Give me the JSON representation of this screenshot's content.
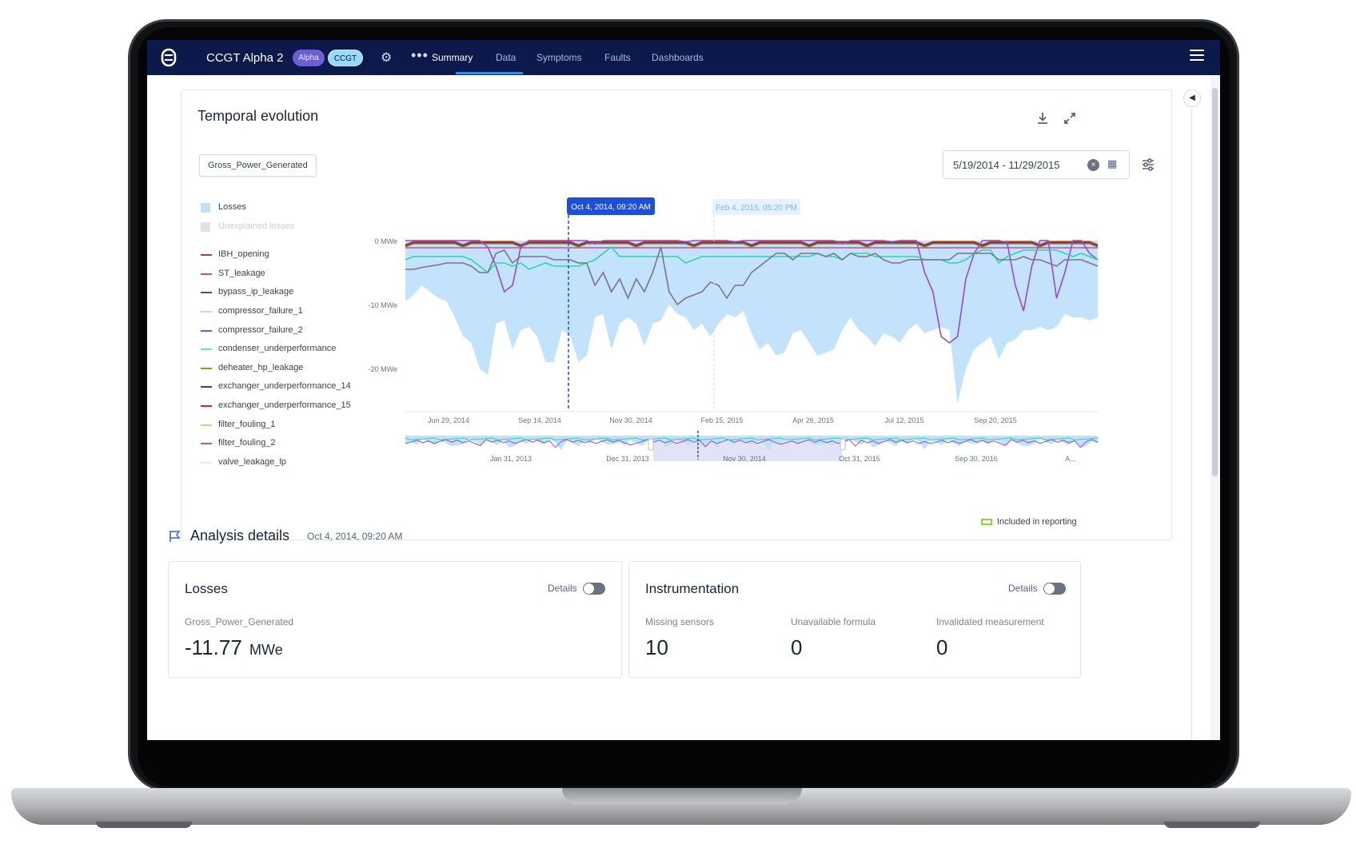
{
  "navbar": {
    "app_title": "CCGT Alpha 2",
    "badge_alpha": "Alpha",
    "badge_ccgt": "CCGT",
    "tabs": [
      {
        "label": "Summary",
        "active": true
      },
      {
        "label": "Data",
        "active": false
      },
      {
        "label": "Symptoms",
        "active": false
      },
      {
        "label": "Faults",
        "active": false
      },
      {
        "label": "Dashboards",
        "active": false
      }
    ],
    "icons": [
      "logo-icon",
      "gear-icon",
      "more-icon",
      "hamburger-menu-icon"
    ]
  },
  "temporal": {
    "title": "Temporal evolution",
    "variable_chip": "Gross_Power_Generated",
    "date_range": "5/19/2014 - 11/29/2015",
    "reporting_label": "Included in reporting",
    "marker_primary": "Oct 4, 2014, 09:20 AM",
    "marker_secondary": "Feb 4, 2015, 05:20 PM",
    "icons": [
      "download-icon",
      "expand-icon",
      "clear-icon",
      "calendar-icon",
      "filter-settings-icon"
    ]
  },
  "legend": {
    "areas": [
      {
        "label": "Losses",
        "color": "#bfe1fb"
      },
      {
        "label": "Unexplained losses",
        "color": "#dfe2e7"
      }
    ],
    "lines": [
      {
        "label": "IBH_opening",
        "color": "#b0413e"
      },
      {
        "label": "ST_leakage",
        "color": "#c75a4e"
      },
      {
        "label": "bypass_ip_leakage",
        "color": "#37538f"
      },
      {
        "label": "compressor_failure_1",
        "color": "#b8e3c8"
      },
      {
        "label": "compressor_failure_2",
        "color": "#9a47d6"
      },
      {
        "label": "condenser_underperformance",
        "color": "#5ee6c8"
      },
      {
        "label": "deheater_hp_leakage",
        "color": "#8a9a12"
      },
      {
        "label": "exchanger_underperformance_14",
        "color": "#3f3a8a"
      },
      {
        "label": "exchanger_underperformance_15",
        "color": "#d42626"
      },
      {
        "label": "filter_fouling_1",
        "color": "#d9d27a"
      },
      {
        "label": "filter_fouling_2",
        "color": "#c24fae"
      },
      {
        "label": "valve_leakage_lp",
        "color": "#e6e6e6"
      }
    ]
  },
  "chart_data": {
    "type": "area",
    "ylabel_ticks": [
      "0 MWe",
      "-10 MWe",
      "-20 MWe"
    ],
    "ylim": [
      -26,
      0
    ],
    "x_ticks": [
      "Jun 29, 2014",
      "Sep 14, 2014",
      "Nov 30, 2014",
      "Feb 15, 2015",
      "Apr 26, 2015",
      "Jul 12, 2015",
      "Sep 20, 2015"
    ],
    "overview_ticks": [
      "Jan 31, 2013",
      "Dec 31, 2013",
      "Nov 30, 2014",
      "Oct 31, 2015",
      "Sep 30, 2016",
      "A..."
    ],
    "series": [
      {
        "name": "Losses",
        "values": [
          -9.5,
          -8.5,
          -7,
          -8,
          -9,
          -9.5,
          -12,
          -15,
          -16,
          -20,
          -21,
          -13,
          -12.5,
          -17,
          -14,
          -13.5,
          -15,
          -19,
          -19,
          -14,
          -15,
          -19,
          -18,
          -12,
          -11.5,
          -17,
          -13,
          -12,
          -13,
          -16.5,
          -13,
          -12.5,
          -10,
          -11.5,
          -12,
          -14,
          -13,
          -15,
          -13,
          -11.5,
          -12,
          -11,
          -14.5,
          -17,
          -16,
          -18,
          -17.5,
          -14.5,
          -14,
          -16,
          -18,
          -17.5,
          -17,
          -14,
          -12,
          -14,
          -15,
          -16.5,
          -14.5,
          -15,
          -16,
          -14,
          -13,
          -14.5,
          -14,
          -13.5,
          -14,
          -25.5,
          -20,
          -17,
          -16,
          -15,
          -18.5,
          -16,
          -15.5,
          -14,
          -14,
          -13.5,
          -14,
          -13.5,
          -11.5,
          -12,
          -12,
          -12.5,
          -12
        ]
      },
      {
        "name": "compressor_failure_2",
        "values": [
          0,
          0,
          0,
          0,
          0,
          0,
          0,
          0,
          0,
          0,
          -1,
          -4,
          -8,
          -7,
          -1,
          0,
          0,
          0,
          0,
          0,
          0,
          0,
          0,
          -0.5,
          0,
          0,
          0,
          0,
          0,
          0,
          0,
          0,
          0,
          0,
          -0.2,
          0,
          0,
          0,
          0,
          0,
          -0.2,
          0,
          0,
          0,
          0,
          0,
          0,
          0,
          0,
          0,
          0,
          0,
          0,
          -0.5,
          0,
          0,
          0,
          0,
          0,
          -0.2,
          0,
          0,
          0,
          -5,
          -8,
          -15,
          -16,
          -15,
          -6,
          -2,
          0,
          0,
          0,
          -0.3,
          -7,
          -11,
          -4,
          0,
          0,
          -9,
          -5,
          0,
          0,
          -2,
          -3
        ]
      },
      {
        "name": "condenser_underperformance",
        "values": [
          -3,
          -2.5,
          -2.5,
          -2.5,
          -2.5,
          -2.5,
          -2.5,
          -2.5,
          -3,
          -4,
          -5,
          -3.5,
          -3.5,
          -4,
          -3.5,
          -4.5,
          -4,
          -3.5,
          -4,
          -4,
          -4,
          -4,
          -3.5,
          -3,
          -2,
          -1,
          -2.5,
          -2.5,
          -2.5,
          -2.5,
          -2.5,
          -2.5,
          -2.5,
          -2.5,
          -3.5,
          -3,
          -2.5,
          -2.5,
          -2.5,
          -2.5,
          -2.5,
          -2.5,
          -2.5,
          -2.5,
          -2.5,
          -2.5,
          -2.5,
          -2.5,
          -2.5,
          -2.5,
          -2,
          -2.5,
          -2.5,
          -3,
          -2,
          -2,
          -2,
          -2.5,
          -2.5,
          -2.5,
          -2.5,
          -2.5,
          -2.5,
          -3,
          -3,
          -3,
          -3.5,
          -3.5,
          -3,
          -2,
          -1.5,
          -1.5,
          -3.5,
          -2.5,
          -2,
          -1.5,
          -1.5,
          -1.5,
          -1.5,
          -1.5,
          -2,
          -2.5,
          -2,
          -2.5,
          -3
        ]
      },
      {
        "name": "IBH_opening",
        "values": [
          -4.5,
          -4.5,
          -4.2,
          -4,
          -3.8,
          -3.5,
          -3.5,
          -3.5,
          -4,
          -5,
          -5,
          -2,
          -1.5,
          -3.5,
          -2.5,
          -2.5,
          -2.5,
          -2.5,
          -3,
          -3,
          -3,
          -3.5,
          -3.5,
          -7,
          -5,
          -8,
          -6,
          -9,
          -6,
          -8,
          -5,
          -1,
          -8,
          -10,
          -9,
          -8.5,
          -8,
          -6.5,
          -7,
          -9,
          -7,
          -7,
          -5,
          -4,
          -3,
          -2,
          -2,
          -3,
          -2,
          -2,
          -2,
          -2.5,
          -2,
          -3,
          -2,
          -2.5,
          -2.5,
          -2,
          -3,
          -3.5,
          -3.5,
          -3,
          -3,
          -3,
          -3,
          -3,
          -3,
          -2,
          -2,
          -2,
          -2,
          -2,
          -3,
          -3,
          -3,
          -2.5,
          -3,
          -3,
          -3.5,
          -4,
          -3,
          -3,
          -3,
          -3.5,
          -4
        ]
      }
    ]
  },
  "analysis": {
    "title": "Analysis details",
    "date": "Oct 4, 2014, 09:20 AM",
    "losses": {
      "title": "Losses",
      "details_label": "Details",
      "metric_label": "Gross_Power_Generated",
      "value": "-11.77",
      "unit": "MWe"
    },
    "instrumentation": {
      "title": "Instrumentation",
      "details_label": "Details",
      "metrics": [
        {
          "label": "Missing sensors",
          "value": "10"
        },
        {
          "label": "Unavailable formula",
          "value": "0"
        },
        {
          "label": "Invalidated measurement",
          "value": "0"
        }
      ]
    }
  }
}
